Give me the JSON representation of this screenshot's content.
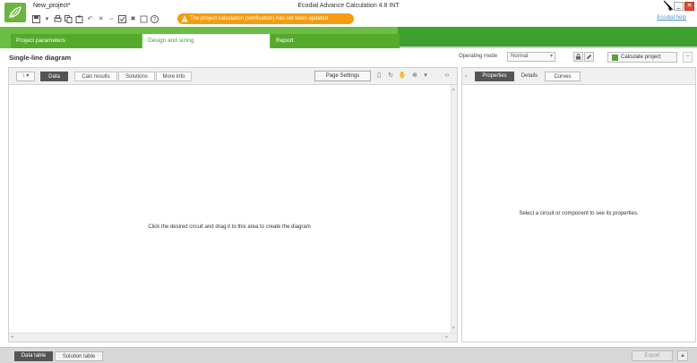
{
  "window": {
    "project_name": "New_project*",
    "app_title": "Ecodial Advance Calculation 4.8 INT",
    "help_link": "Ecodial.help",
    "minimize_label": "_",
    "close_label": "✕"
  },
  "toolbar": {
    "icons": [
      "save-icon",
      "dropdown-icon",
      "print-icon",
      "copy-icon",
      "paste-icon",
      "undo-icon",
      "delete-icon",
      "link-icon",
      "check-icon",
      "tools-icon",
      "square-icon",
      "help-icon"
    ],
    "warning": "The project calculation (verification) has not been updated"
  },
  "main_tabs": [
    {
      "label": "Project parameters",
      "active": false
    },
    {
      "label": "Design and sizing",
      "active": true
    },
    {
      "label": "Report",
      "active": false
    }
  ],
  "subheader": {
    "title": "Single-line diagram",
    "operating_mode_label": "Operating mode",
    "operating_mode_value": "Normal",
    "calculate_button": "Calculate project",
    "collapse_label": "−"
  },
  "left_panel": {
    "dropdown_label": "↕ ▾",
    "tabs": [
      {
        "label": "Data",
        "active": true
      },
      {
        "label": "Calc results",
        "active": false
      },
      {
        "label": "Solutions",
        "active": false
      },
      {
        "label": "More info",
        "active": false
      }
    ],
    "page_settings_button": "Page Settings",
    "placeholder_message": "Click the desired circuit and drag it to this area to create the diagram"
  },
  "right_panel": {
    "expand_label": "›",
    "tabs": [
      {
        "label": "Properties",
        "active": true
      },
      {
        "label": "Details",
        "active": false
      },
      {
        "label": "Curves",
        "active": false
      }
    ],
    "placeholder_message": "Select a circuit or component to see its properties."
  },
  "bottom_bar": {
    "tabs": [
      {
        "label": "Data table",
        "active": true
      },
      {
        "label": "Solution table",
        "active": false
      }
    ],
    "export_button": "Export",
    "collapse_label": "▴"
  },
  "colors": {
    "brand_green": "#3da02d",
    "tab_green_light": "#6cbd45",
    "warning_orange": "#f39c12",
    "close_red": "#e04a3a"
  }
}
